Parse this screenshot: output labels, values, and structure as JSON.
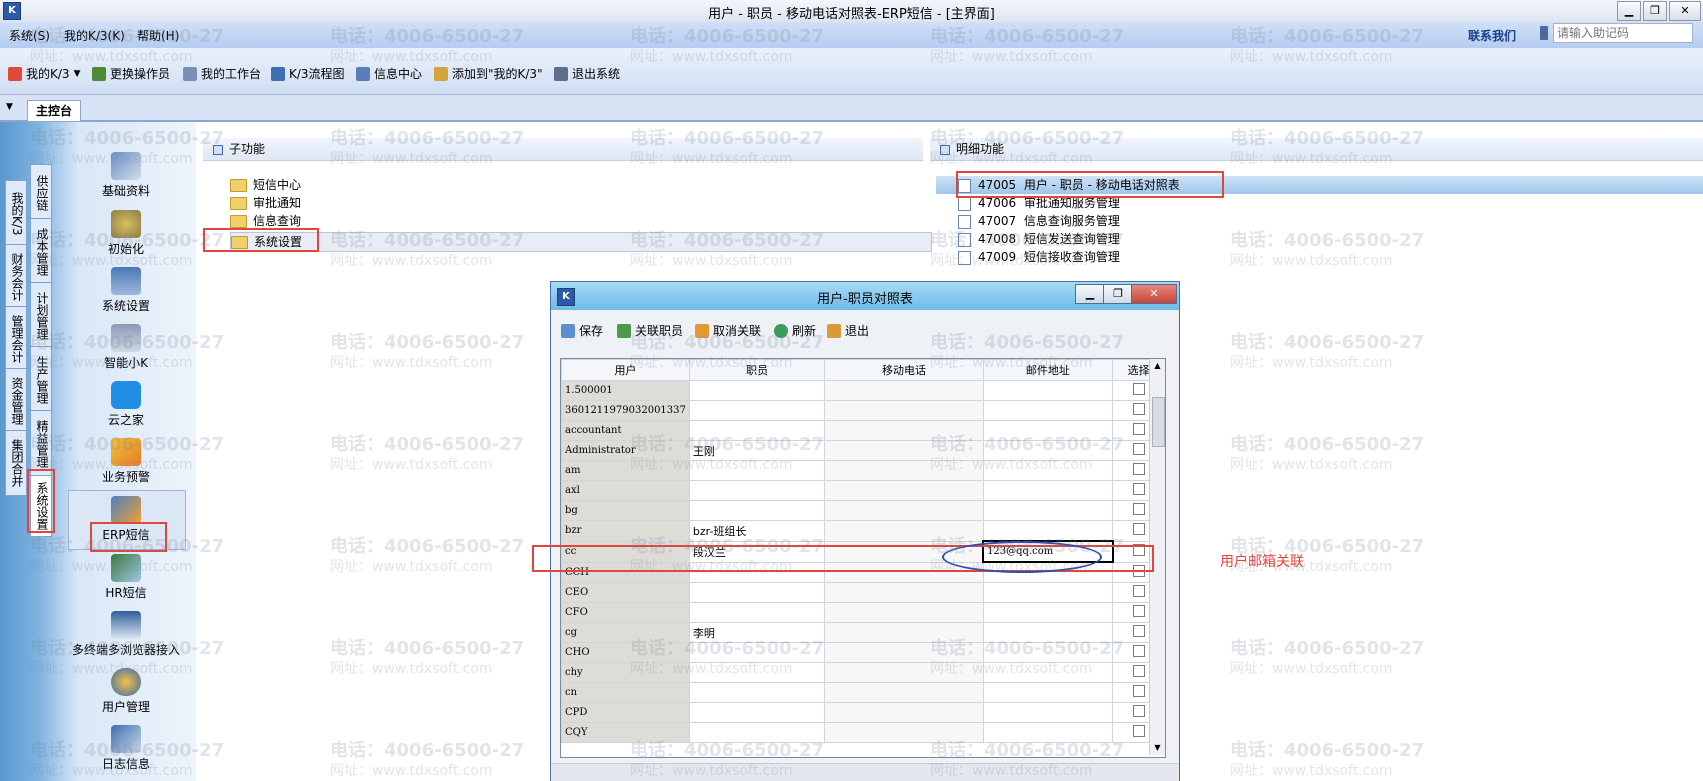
{
  "window": {
    "title": "用户 - 职员 - 移动电话对照表-ERP短信 - [主界面]",
    "controls": [
      "▁",
      "❐",
      "✕"
    ]
  },
  "menu": {
    "items": [
      "系统(S)",
      "我的K/3(K)",
      "帮助(H)"
    ],
    "contact": "联系我们",
    "search_placeholder": "请输入助记码"
  },
  "toolbar": {
    "items": [
      "我的K/3",
      "更换操作员",
      "我的工作台",
      "K/3流程图",
      "信息中心",
      "添加到\"我的K/3\"",
      "退出系统"
    ]
  },
  "tabs": {
    "main": "主控台"
  },
  "sidebar": {
    "vtabs": [
      "我的K/3",
      "财务会计",
      "管理会计",
      "资金管理",
      "集团合并"
    ],
    "vtabs2": [
      "供应链",
      "成本管理",
      "计划管理",
      "生产管理",
      "精益管理",
      "系统设置"
    ],
    "items": [
      "基础资料",
      "初始化",
      "系统设置",
      "智能小K",
      "云之家",
      "业务预警",
      "ERP短信",
      "HR短信",
      "多终端多浏览器接入",
      "用户管理",
      "日志信息"
    ]
  },
  "subfunc": {
    "header": "子功能",
    "items": [
      "短信中心",
      "审批通知",
      "信息查询",
      "系统设置"
    ]
  },
  "detail": {
    "header": "明细功能",
    "items": [
      {
        "code": "47005",
        "label": "用户 - 职员 - 移动电话对照表"
      },
      {
        "code": "47006",
        "label": "审批通知服务管理"
      },
      {
        "code": "47007",
        "label": "信息查询服务管理"
      },
      {
        "code": "47008",
        "label": "短信发送查询管理"
      },
      {
        "code": "47009",
        "label": "短信接收查询管理"
      }
    ]
  },
  "dialog": {
    "title": "用户-职员对照表",
    "buttons": [
      "保存",
      "关联职员",
      "取消关联",
      "刷新",
      "退出"
    ],
    "columns": [
      "用户",
      "职员",
      "移动电话",
      "邮件地址",
      "选择"
    ],
    "rows": [
      [
        "1.500001",
        "",
        "",
        ""
      ],
      [
        "3601211979032001337",
        "",
        "",
        ""
      ],
      [
        "accountant",
        "",
        "",
        ""
      ],
      [
        "Administrator",
        "王刚",
        "",
        ""
      ],
      [
        "am",
        "",
        "",
        ""
      ],
      [
        "axl",
        "",
        "",
        ""
      ],
      [
        "bg",
        "",
        "",
        ""
      ],
      [
        "bzr",
        "bzr-班组长",
        "",
        ""
      ],
      [
        "cc",
        "段汉兰",
        "",
        "123@qq.com"
      ],
      [
        "CCH",
        "",
        "",
        ""
      ],
      [
        "CEO",
        "",
        "",
        ""
      ],
      [
        "CFO",
        "",
        "",
        ""
      ],
      [
        "cg",
        "李明",
        "",
        ""
      ],
      [
        "CHO",
        "",
        "",
        ""
      ],
      [
        "chy",
        "",
        "",
        ""
      ],
      [
        "cn",
        "",
        "",
        ""
      ],
      [
        "CPD",
        "",
        "",
        ""
      ],
      [
        "CQY",
        "",
        "",
        ""
      ]
    ]
  },
  "annotation": "用户邮箱关联",
  "watermark": {
    "phone": "电话：4006-6500-27",
    "site": "网址：www.tdxsoft.com"
  },
  "colors": {
    "accent": "#e0463c",
    "dialog_title": "#6dbbe9",
    "ellipse": "#2f4db0"
  }
}
